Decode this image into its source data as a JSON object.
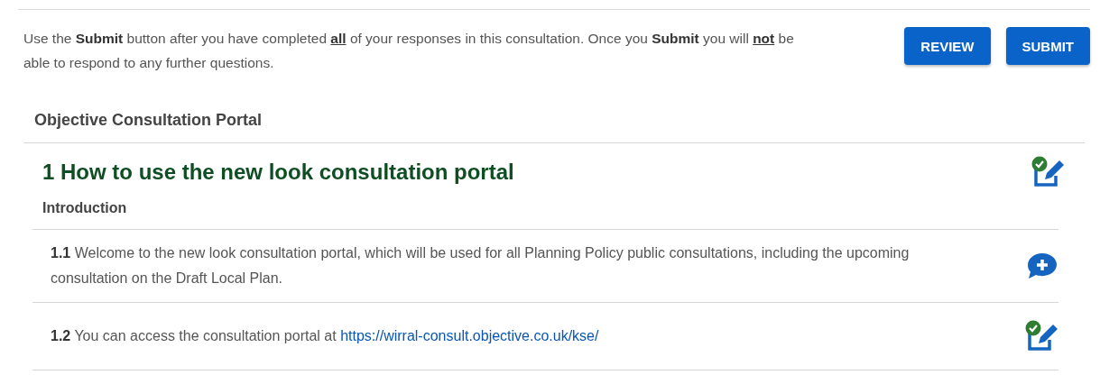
{
  "notice": {
    "parts": [
      {
        "text": "Use the ",
        "kind": "plain"
      },
      {
        "text": "Submit",
        "kind": "bold"
      },
      {
        "text": " button after you have completed ",
        "kind": "plain"
      },
      {
        "text": "all",
        "kind": "emphasis"
      },
      {
        "text": " of your responses in this consultation. Once you ",
        "kind": "plain"
      },
      {
        "text": "Submit",
        "kind": "bold"
      },
      {
        "text": " you will ",
        "kind": "plain"
      },
      {
        "text": "not",
        "kind": "emphasis"
      },
      {
        "text": " be able to respond to any further questions.",
        "kind": "plain"
      }
    ]
  },
  "buttons": [
    "REVIEW",
    "SUBMIT"
  ],
  "portal_title": "Objective Consultation Portal",
  "section": {
    "title": "1 How to use the new look consultation portal",
    "kind": "edited",
    "subtitle": "Introduction",
    "items": [
      {
        "number": "1.1",
        "text": "Welcome to the new look consultation portal, which will be used for all Planning Policy public consultations, including the upcoming consultation on the Draft Local Plan.",
        "kind": "comment"
      },
      {
        "number": "1.2",
        "text": "You can access the consultation portal at ",
        "link": "https://wirral-consult.objective.co.uk/kse/",
        "kind": "edited"
      }
    ]
  }
}
